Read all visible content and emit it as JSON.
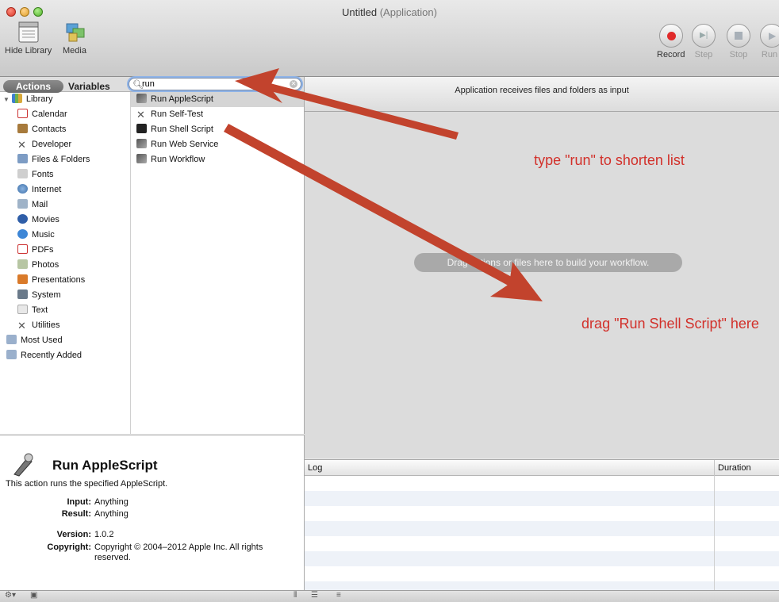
{
  "window": {
    "title": "Untitled",
    "subtitle": "(Application)"
  },
  "toolbar": {
    "hide_library": "Hide Library",
    "media": "Media",
    "record": "Record",
    "step": "Step",
    "stop": "Stop",
    "run": "Run"
  },
  "library_header": {
    "actions_tab": "Actions",
    "variables_tab": "Variables",
    "search_value": "run"
  },
  "categories": [
    "Library",
    "Calendar",
    "Contacts",
    "Developer",
    "Files & Folders",
    "Fonts",
    "Internet",
    "Mail",
    "Movies",
    "Music",
    "PDFs",
    "Photos",
    "Presentations",
    "System",
    "Text",
    "Utilities",
    "Most Used",
    "Recently Added"
  ],
  "actions": [
    "Run AppleScript",
    "Run Self-Test",
    "Run Shell Script",
    "Run Web Service",
    "Run Workflow"
  ],
  "info": {
    "title": "Run AppleScript",
    "description": "This action runs the specified AppleScript.",
    "input_label": "Input:",
    "input_value": "Anything",
    "result_label": "Result:",
    "result_value": "Anything",
    "version_label": "Version:",
    "version_value": "1.0.2",
    "copyright_label": "Copyright:",
    "copyright_value": "Copyright © 2004–2012 Apple Inc.  All rights reserved."
  },
  "workflow": {
    "header": "Application receives files and folders as input",
    "drop_hint": "Drag actions or files here to build your workflow."
  },
  "annotations": {
    "note1": "type \"run\" to shorten list",
    "note2": "drag \"Run Shell Script\" here"
  },
  "log": {
    "col_log": "Log",
    "col_duration": "Duration"
  },
  "colors": {
    "annotation": "#d2302a",
    "arrow": "#c2432d",
    "selection": "#d5d5d5"
  }
}
